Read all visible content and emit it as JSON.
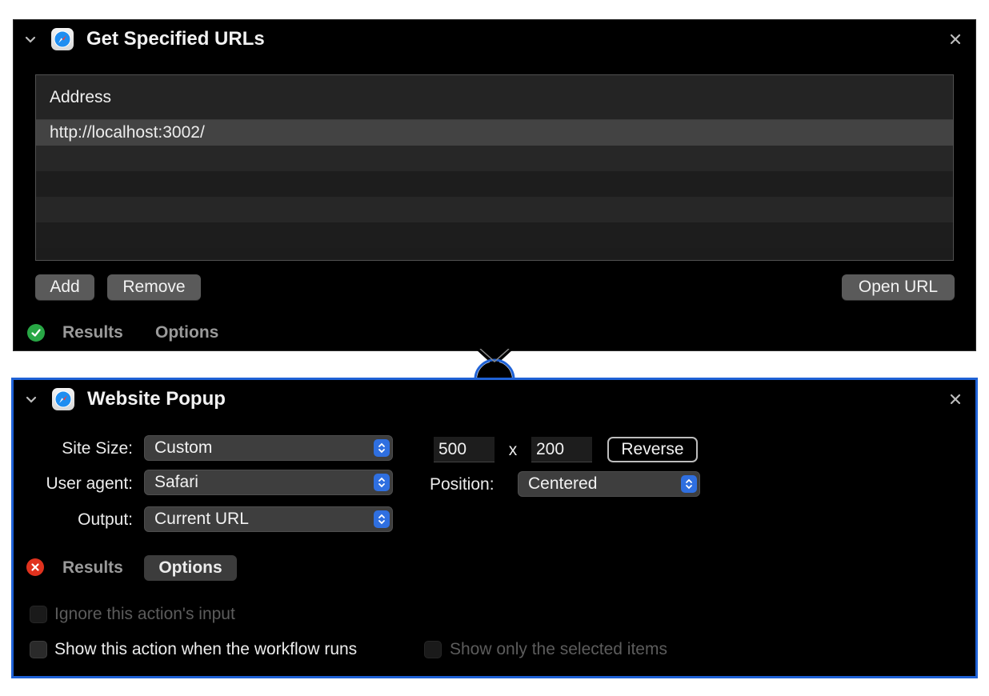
{
  "action1": {
    "title": "Get Specified URLs",
    "table": {
      "header": "Address",
      "rows": [
        "http://localhost:3002/",
        "",
        "",
        "",
        ""
      ]
    },
    "buttons": {
      "add": "Add",
      "remove": "Remove",
      "open_url": "Open URL"
    },
    "status": "success",
    "tabs": {
      "results": "Results",
      "options": "Options"
    }
  },
  "action2": {
    "title": "Website Popup",
    "site_size": {
      "label": "Site Size:",
      "value": "Custom"
    },
    "user_agent": {
      "label": "User agent:",
      "value": "Safari"
    },
    "output": {
      "label": "Output:",
      "value": "Current URL"
    },
    "width": "500",
    "x": "x",
    "height": "200",
    "reverse": "Reverse",
    "position": {
      "label": "Position:",
      "value": "Centered"
    },
    "status": "error",
    "tabs": {
      "results": "Results",
      "options": "Options"
    },
    "checkboxes": {
      "ignore_input": "Ignore this action's input",
      "show_action": "Show this action when the workflow runs",
      "show_selected": "Show only the selected items"
    }
  },
  "colors": {
    "accent": "#1f62d6",
    "success": "#28a745",
    "error": "#e0321e"
  },
  "icons": [
    "chevron-down-icon",
    "safari-icon",
    "close-icon",
    "check-icon",
    "x-icon",
    "stepper-icon"
  ]
}
